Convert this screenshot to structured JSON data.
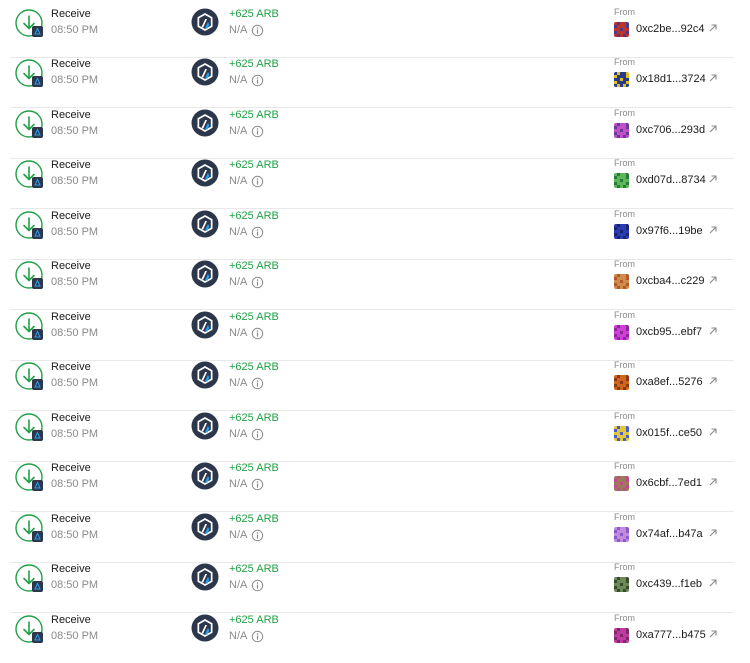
{
  "transactions": [
    {
      "type": "Receive",
      "time": "08:50 PM",
      "amount": "+625 ARB",
      "value": "N/A",
      "from_label": "From",
      "address": "0xc2be...92c4",
      "avatar_colors": [
        "#c0332a",
        "#4a3a8a"
      ],
      "icon": "receive-arrow-icon"
    },
    {
      "type": "Receive",
      "time": "08:50 PM",
      "amount": "+625 ARB",
      "value": "N/A",
      "from_label": "From",
      "address": "0x18d1...3724",
      "avatar_colors": [
        "#2a3a8a",
        "#e0c21a"
      ],
      "icon": "receive-arrow-icon"
    },
    {
      "type": "Receive",
      "time": "08:50 PM",
      "amount": "+625 ARB",
      "value": "N/A",
      "from_label": "From",
      "address": "0xc706...293d",
      "avatar_colors": [
        "#c050c8",
        "#6a3a9a"
      ],
      "icon": "receive-arrow-icon"
    },
    {
      "type": "Receive",
      "time": "08:50 PM",
      "amount": "+625 ARB",
      "value": "N/A",
      "from_label": "From",
      "address": "0xd07d...8734",
      "avatar_colors": [
        "#5ab85a",
        "#2a7a3a"
      ],
      "icon": "receive-arrow-icon"
    },
    {
      "type": "Receive",
      "time": "08:50 PM",
      "amount": "+625 ARB",
      "value": "N/A",
      "from_label": "From",
      "address": "0x97f6...19be",
      "avatar_colors": [
        "#2a3ab0",
        "#1a2470"
      ],
      "icon": "receive-arrow-icon"
    },
    {
      "type": "Receive",
      "time": "08:50 PM",
      "amount": "+625 ARB",
      "value": "N/A",
      "from_label": "From",
      "address": "0xcba4...c229",
      "avatar_colors": [
        "#d08a4a",
        "#b05a2a"
      ],
      "icon": "receive-arrow-icon"
    },
    {
      "type": "Receive",
      "time": "08:50 PM",
      "amount": "+625 ARB",
      "value": "N/A",
      "from_label": "From",
      "address": "0xcb95...ebf7",
      "avatar_colors": [
        "#d040d8",
        "#8a2a9a"
      ],
      "icon": "receive-arrow-icon"
    },
    {
      "type": "Receive",
      "time": "08:50 PM",
      "amount": "+625 ARB",
      "value": "N/A",
      "from_label": "From",
      "address": "0xa8ef...5276",
      "avatar_colors": [
        "#d0661a",
        "#8a3a1a"
      ],
      "icon": "receive-arrow-icon"
    },
    {
      "type": "Receive",
      "time": "08:50 PM",
      "amount": "+625 ARB",
      "value": "N/A",
      "from_label": "From",
      "address": "0x015f...ce50",
      "avatar_colors": [
        "#e0c83a",
        "#4a5ad0"
      ],
      "icon": "receive-arrow-icon"
    },
    {
      "type": "Receive",
      "time": "08:50 PM",
      "amount": "+625 ARB",
      "value": "N/A",
      "from_label": "From",
      "address": "0x6cbf...7ed1",
      "avatar_colors": [
        "#9a7a5a",
        "#c04a8a"
      ],
      "icon": "receive-arrow-icon"
    },
    {
      "type": "Receive",
      "time": "08:50 PM",
      "amount": "+625 ARB",
      "value": "N/A",
      "from_label": "From",
      "address": "0x74af...b47a",
      "avatar_colors": [
        "#c08ae0",
        "#8a5ac8"
      ],
      "icon": "receive-arrow-icon"
    },
    {
      "type": "Receive",
      "time": "08:50 PM",
      "amount": "+625 ARB",
      "value": "N/A",
      "from_label": "From",
      "address": "0xc439...f1eb",
      "avatar_colors": [
        "#6a8a5a",
        "#3a4a2a"
      ],
      "icon": "receive-arrow-icon"
    },
    {
      "type": "Receive",
      "time": "08:50 PM",
      "amount": "+625 ARB",
      "value": "N/A",
      "from_label": "From",
      "address": "0xa777...b475",
      "avatar_colors": [
        "#c03aa0",
        "#7a2a6a"
      ],
      "icon": "receive-arrow-icon"
    }
  ],
  "colors": {
    "accent_green": "#20a045",
    "muted_text": "#8a8a8a",
    "arb_dark": "#2d374b",
    "arb_blue": "#28a0f0"
  }
}
